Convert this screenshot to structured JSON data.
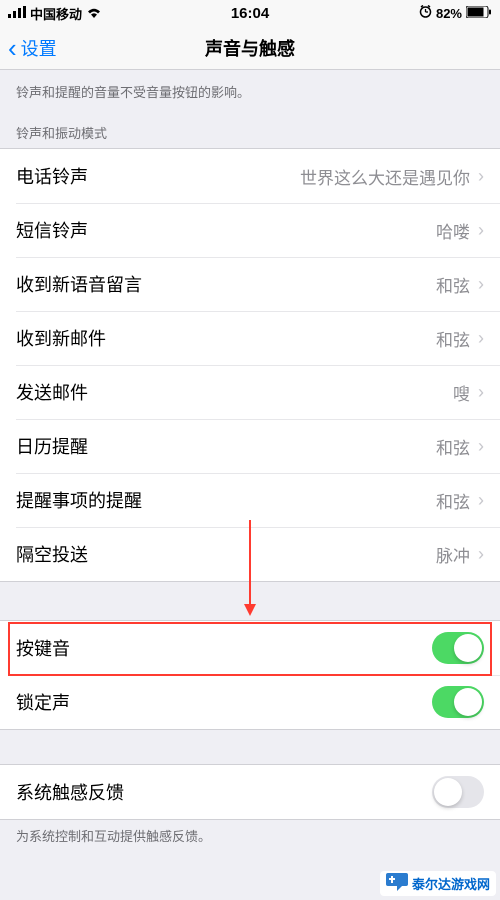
{
  "statusBar": {
    "signal": "•••",
    "carrier": "中国移动",
    "wifi": "wifi",
    "time": "16:04",
    "alarm": "alarm",
    "battery": "82%"
  },
  "nav": {
    "back": "设置",
    "title": "声音与触感"
  },
  "headerDesc": "铃声和提醒的音量不受音量按钮的影响。",
  "section1Header": "铃声和振动模式",
  "section1": [
    {
      "label": "电话铃声",
      "value": "世界这么大还是遇见你"
    },
    {
      "label": "短信铃声",
      "value": "哈喽"
    },
    {
      "label": "收到新语音留言",
      "value": "和弦"
    },
    {
      "label": "收到新邮件",
      "value": "和弦"
    },
    {
      "label": "发送邮件",
      "value": "嗖"
    },
    {
      "label": "日历提醒",
      "value": "和弦"
    },
    {
      "label": "提醒事项的提醒",
      "value": "和弦"
    },
    {
      "label": "隔空投送",
      "value": "脉冲"
    }
  ],
  "section2": [
    {
      "label": "按键音",
      "on": true
    },
    {
      "label": "锁定声",
      "on": true
    }
  ],
  "section3": [
    {
      "label": "系统触感反馈",
      "on": false
    }
  ],
  "footerDesc": "为系统控制和互动提供触感反馈。",
  "watermark": {
    "text": "泰尔达游戏网",
    "url": "www.tairda.com"
  }
}
